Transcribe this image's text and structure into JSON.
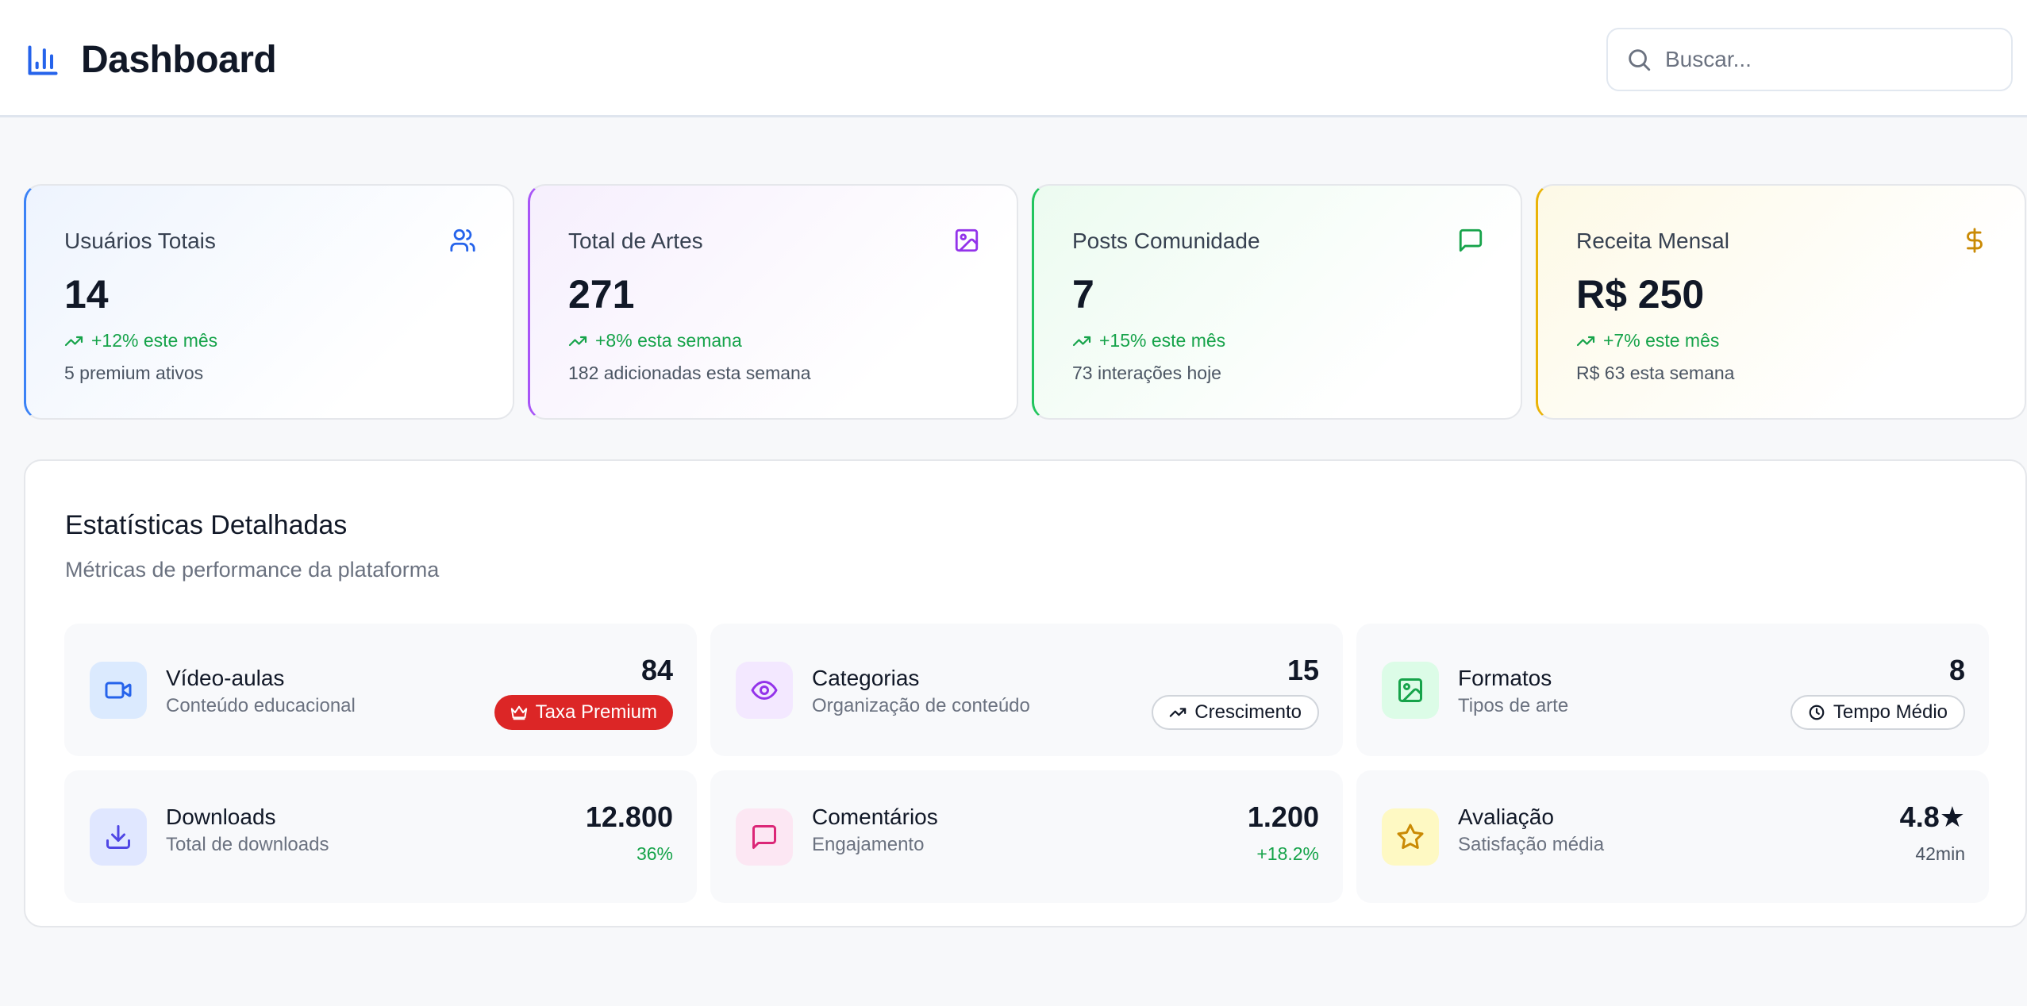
{
  "header": {
    "title": "Dashboard",
    "icon": "bar-chart-icon",
    "search": {
      "placeholder": "Buscar...",
      "value": ""
    }
  },
  "stat_cards": [
    {
      "label": "Usuários Totais",
      "value": "14",
      "trend": "+12% este mês",
      "sub": "5 premium ativos",
      "icon": "users-icon",
      "color": "#3b82f6"
    },
    {
      "label": "Total de Artes",
      "value": "271",
      "trend": "+8% esta semana",
      "sub": "182 adicionadas esta semana",
      "icon": "image-icon",
      "color": "#a855f7"
    },
    {
      "label": "Posts Comunidade",
      "value": "7",
      "trend": "+15% este mês",
      "sub": "73 interações hoje",
      "icon": "message-square-icon",
      "color": "#22c55e"
    },
    {
      "label": "Receita Mensal",
      "value": "R$ 250",
      "trend": "+7% este mês",
      "sub": "R$ 63 esta semana",
      "icon": "dollar-sign-icon",
      "color": "#eab308"
    }
  ],
  "details": {
    "title": "Estatísticas Detalhadas",
    "subtitle": "Métricas de performance da plataforma",
    "metrics": [
      {
        "title": "Vídeo-aulas",
        "sub": "Conteúdo educacional",
        "value": "84",
        "badge": "Taxa Premium",
        "icon": "video-icon",
        "badge_icon": "crown-icon"
      },
      {
        "title": "Categorias",
        "sub": "Organização de conteúdo",
        "value": "15",
        "badge": "Crescimento",
        "icon": "eye-icon",
        "badge_icon": "trending-up-icon"
      },
      {
        "title": "Formatos",
        "sub": "Tipos de arte",
        "value": "8",
        "badge": "Tempo Médio",
        "icon": "image-icon",
        "badge_icon": "clock-icon"
      },
      {
        "title": "Downloads",
        "sub": "Total de downloads",
        "value": "12.800",
        "delta": "36%",
        "icon": "download-icon"
      },
      {
        "title": "Comentários",
        "sub": "Engajamento",
        "value": "1.200",
        "delta": "+18.2%",
        "icon": "message-square-icon"
      },
      {
        "title": "Avaliação",
        "sub": "Satisfação média",
        "value": "4.8★",
        "delta": "42min",
        "icon": "star-icon"
      }
    ]
  },
  "colors": {
    "background": "#f7f8fa",
    "positive": "#16a34a",
    "premium_badge": "#dc2626",
    "brand": "#2563eb"
  }
}
